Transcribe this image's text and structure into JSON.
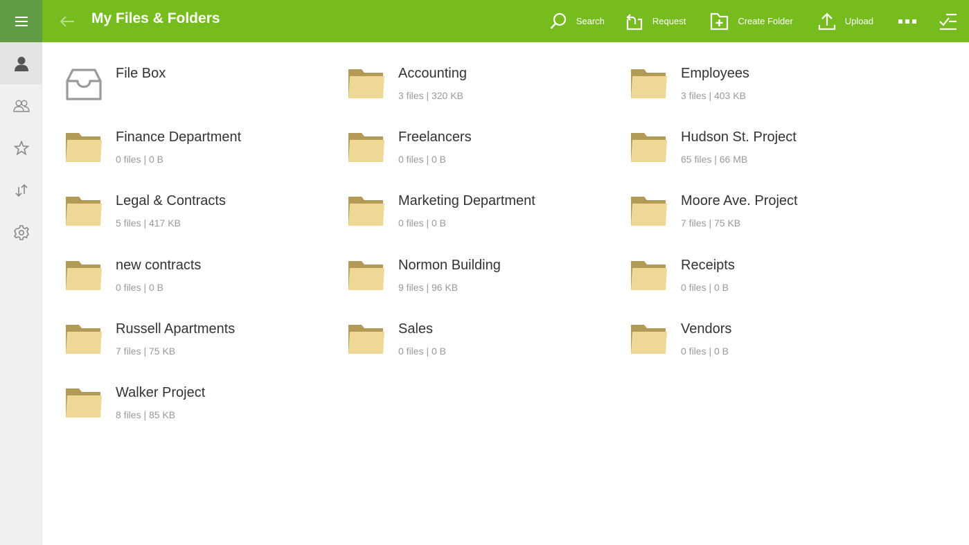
{
  "header": {
    "title": "My Files & Folders",
    "menu_icon": "hamburger-icon",
    "back_icon": "back-arrow-icon",
    "actions": [
      {
        "label": "Search",
        "icon": "search-icon"
      },
      {
        "label": "Request",
        "icon": "request-icon"
      },
      {
        "label": "Create Folder",
        "icon": "create-folder-icon"
      },
      {
        "label": "Upload",
        "icon": "upload-icon"
      }
    ],
    "more_icon": "more-icon",
    "select_icon": "select-checklist-icon"
  },
  "sidebar": {
    "items": [
      {
        "name": "my-files",
        "icon": "person-icon",
        "active": true
      },
      {
        "name": "shared",
        "icon": "people-icon",
        "active": false
      },
      {
        "name": "favorites",
        "icon": "star-icon",
        "active": false
      },
      {
        "name": "transfers",
        "icon": "transfer-arrows-icon",
        "active": false
      },
      {
        "name": "settings",
        "icon": "gear-icon",
        "active": false
      }
    ]
  },
  "colors": {
    "header": "#77bc1f",
    "header_dark": "#5f9c44",
    "folder_front": "#efd896",
    "folder_back": "#b39a57"
  },
  "items": [
    {
      "name": "File Box",
      "meta": "",
      "type": "filebox"
    },
    {
      "name": "Accounting",
      "meta": "3 files | 320 KB",
      "type": "folder"
    },
    {
      "name": "Employees",
      "meta": "3 files | 403 KB",
      "type": "folder"
    },
    {
      "name": "Finance Department",
      "meta": "0 files | 0 B",
      "type": "folder"
    },
    {
      "name": "Freelancers",
      "meta": "0 files | 0 B",
      "type": "folder"
    },
    {
      "name": "Hudson St. Project",
      "meta": "65 files | 66 MB",
      "type": "folder"
    },
    {
      "name": "Legal & Contracts",
      "meta": "5 files | 417 KB",
      "type": "folder"
    },
    {
      "name": "Marketing Department",
      "meta": "0 files | 0 B",
      "type": "folder"
    },
    {
      "name": "Moore Ave. Project",
      "meta": "7 files | 75 KB",
      "type": "folder"
    },
    {
      "name": "new contracts",
      "meta": "0 files | 0 B",
      "type": "folder"
    },
    {
      "name": "Normon Building",
      "meta": "9 files | 96 KB",
      "type": "folder"
    },
    {
      "name": "Receipts",
      "meta": "0 files | 0 B",
      "type": "folder"
    },
    {
      "name": "Russell Apartments",
      "meta": "7 files | 75 KB",
      "type": "folder"
    },
    {
      "name": "Sales",
      "meta": "0 files | 0 B",
      "type": "folder"
    },
    {
      "name": "Vendors",
      "meta": "0 files | 0 B",
      "type": "folder"
    },
    {
      "name": "Walker Project",
      "meta": "8 files | 85 KB",
      "type": "folder"
    }
  ]
}
